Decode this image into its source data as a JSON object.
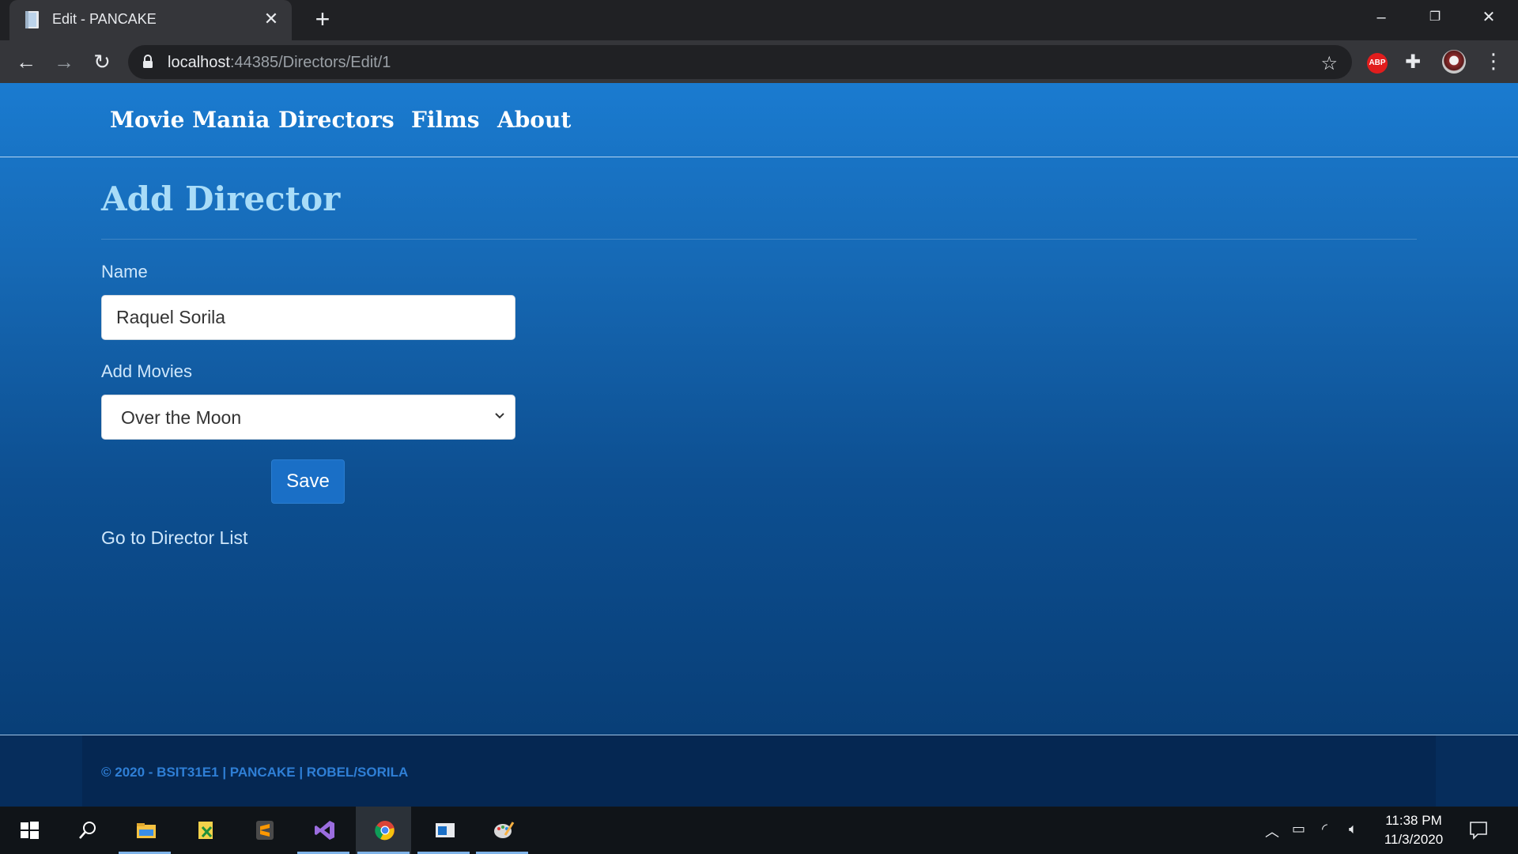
{
  "browser": {
    "tab_title": "Edit - PANCAKE",
    "url_host": "localhost",
    "url_path": ":44385/Directors/Edit/1",
    "extension_abp_label": "ABP"
  },
  "site": {
    "nav": [
      "Movie Mania",
      "Directors",
      "Films",
      "About"
    ],
    "heading": "Add Director",
    "name_label": "Name",
    "name_value": "Raquel Sorila",
    "movies_label": "Add Movies",
    "movies_selected": "Over the Moon",
    "save_label": "Save",
    "back_link": "Go to Director List",
    "footer": "© 2020 - BSIT31E1 | PANCAKE | ROBEL/SORILA"
  },
  "taskbar": {
    "time": "11:38 PM",
    "date": "11/3/2020",
    "apps": [
      "file-explorer",
      "xampp",
      "sublime-text",
      "visual-studio",
      "chrome",
      "edit-window",
      "paint"
    ]
  },
  "colors": {
    "nav_gradient_top": "#1a7bd0",
    "nav_gradient_bottom": "#073a70",
    "heading": "#a8dcf8",
    "save_button": "#1a6fc6",
    "footer_text": "#2f7fd6"
  }
}
